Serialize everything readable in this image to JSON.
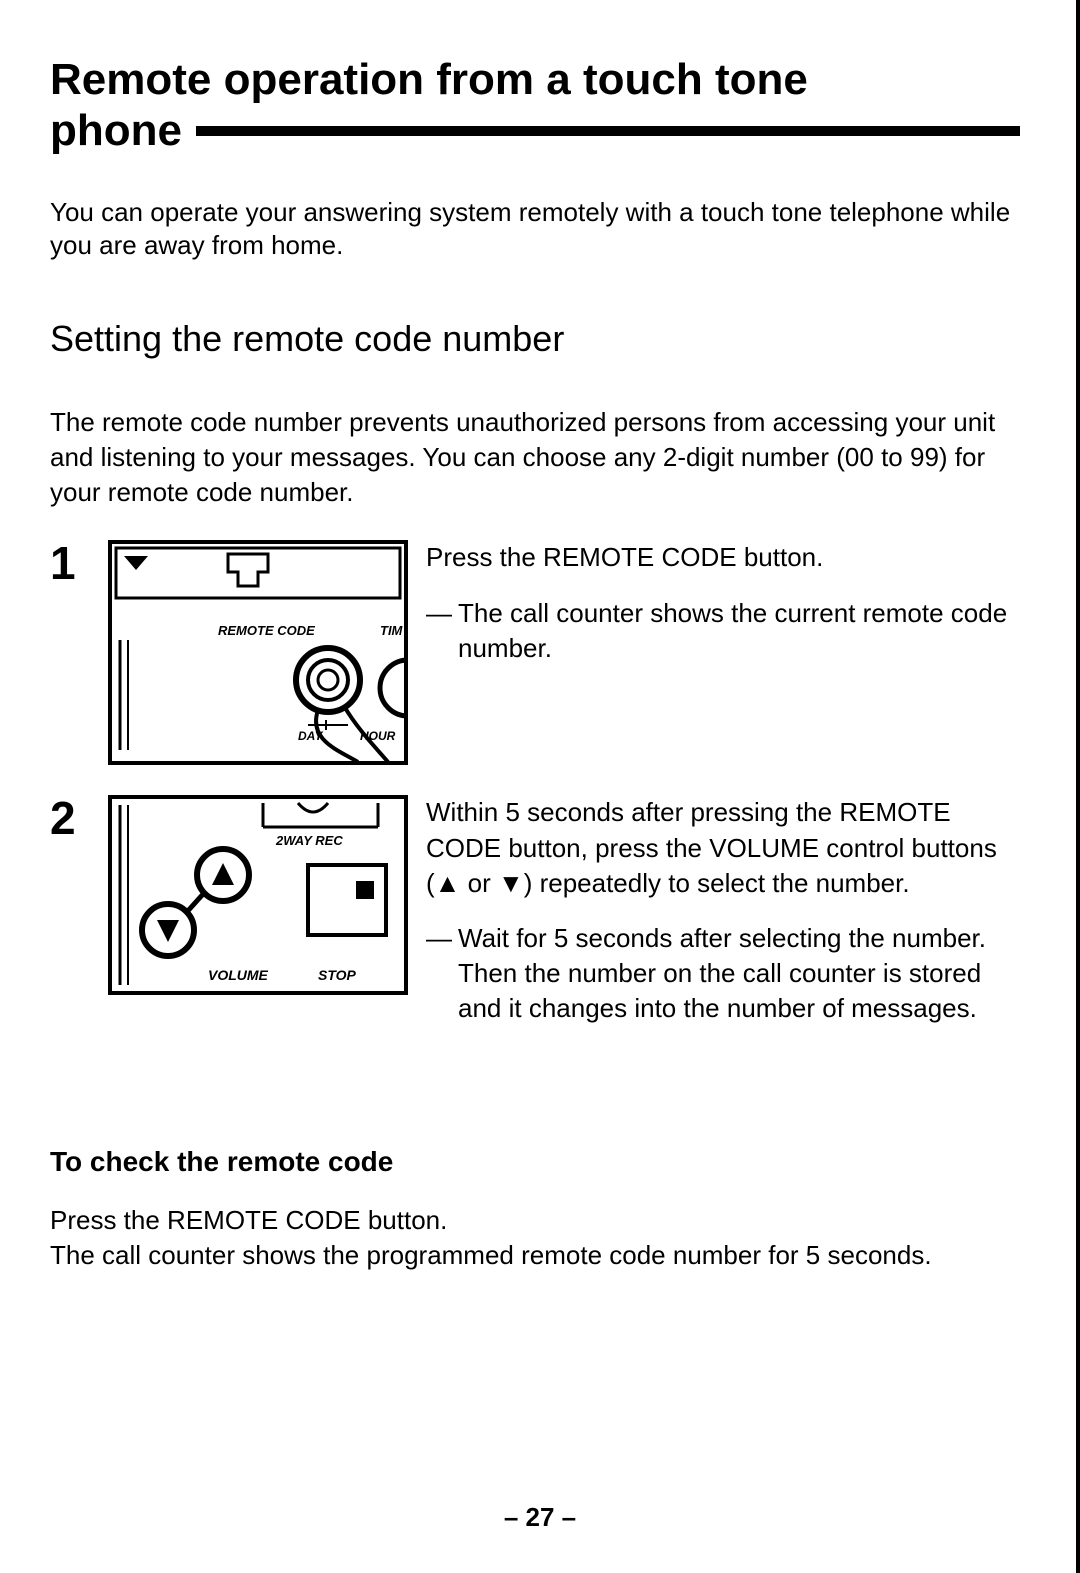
{
  "title": {
    "line1": "Remote operation from a touch tone",
    "line2": "phone"
  },
  "intro": "You can operate your answering system remotely with a touch tone telephone while you are away from home.",
  "section": {
    "heading": "Setting the remote code number",
    "body": "The remote code number prevents unauthorized persons from accessing your unit and listening to your messages. You can choose any 2-digit number (00 to 99) for your remote code number."
  },
  "steps": [
    {
      "num": "1",
      "fig_labels": {
        "remote_code": "REMOTE CODE",
        "tim": "TIM",
        "day": "DAY",
        "hour": "HOUR"
      },
      "text": "Press the REMOTE CODE button.",
      "note": "The call counter shows the current remote code number."
    },
    {
      "num": "2",
      "fig_labels": {
        "twoway_rec": "2WAY REC",
        "volume": "VOLUME",
        "stop": "STOP"
      },
      "text": "Within 5 seconds after pressing the REMOTE CODE button, press the VOLUME control buttons (▲ or ▼) repeatedly to select the number.",
      "note": "Wait for 5 seconds after selecting the number. Then the number on the call counter is stored and it changes into the number of messages."
    }
  ],
  "check": {
    "heading": "To check the remote code",
    "line1": "Press the REMOTE CODE button.",
    "line2": "The call counter shows the programmed remote code number for 5 seconds."
  },
  "page_number": "– 27 –"
}
